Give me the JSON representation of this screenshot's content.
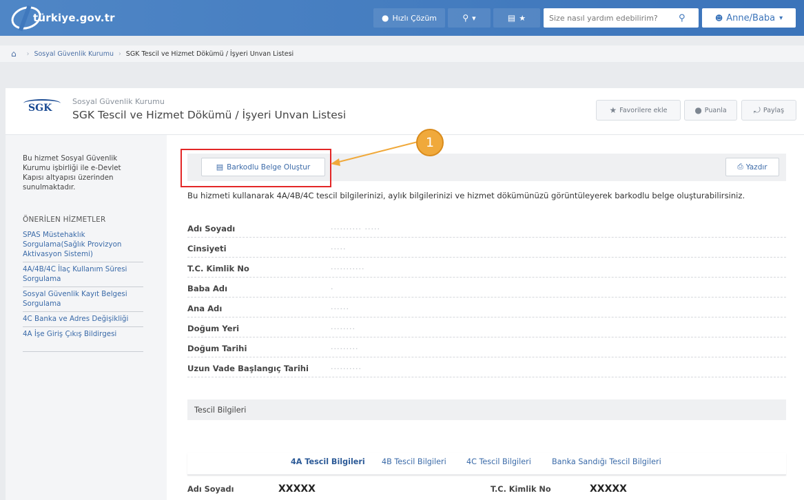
{
  "topbar": {
    "logo_text": "türkiye.gov.tr",
    "quick_solution_label": "Hızlı Çözüm",
    "search_placeholder": "Size nasıl yardım edebilirim?",
    "user_label": "Anne/Baba"
  },
  "breadcrumb": {
    "items": [
      "Sosyal Güvenlik Kurumu",
      "SGK Tescil ve Hizmet Dökümü / İşyeri Unvan Listesi"
    ]
  },
  "header": {
    "logo_text": "SGK",
    "org": "Sosyal Güvenlik Kurumu",
    "title": "SGK Tescil ve Hizmet Dökümü / İşyeri Unvan Listesi",
    "favorite_label": "Favorilere ekle",
    "rate_label": "Puanla",
    "share_label": "Paylaş"
  },
  "sidebar": {
    "description": "Bu hizmet Sosyal Güvenlik Kurumu işbirliği ile e-Devlet Kapısı altyapısı üzerinden sunulmaktadır.",
    "recommended_heading": "ÖNERİLEN HİZMETLER",
    "items": [
      "SPAS Müstehaklık Sorgulama(Sağlık Provizyon Aktivasyon Sistemi)",
      "4A/4B/4C İlaç Kullanım Süresi Sorgulama",
      "Sosyal Güvenlik Kayıt Belgesi Sorgulama",
      "4C Banka ve Adres Değişikliği",
      "4A İşe Giriş Çıkış Bildirgesi"
    ]
  },
  "content": {
    "barcode_button_label": "Barkodlu Belge Oluştur",
    "print_button_label": "Yazdır",
    "description": "Bu hizmeti kullanarak 4A/4B/4C tescil bilgilerinizi, aylık bilgilerinizi ve hizmet dökümünüzü görüntüleyerek barkodlu belge oluşturabilirsiniz.",
    "fields": [
      {
        "label": "Adı Soyadı",
        "value": "·········· ·····"
      },
      {
        "label": "Cinsiyeti",
        "value": "·····"
      },
      {
        "label": "T.C. Kimlik No",
        "value": "···········"
      },
      {
        "label": "Baba Adı",
        "value": "·"
      },
      {
        "label": "Ana Adı",
        "value": "······"
      },
      {
        "label": "Doğum Yeri",
        "value": "········"
      },
      {
        "label": "Doğum Tarihi",
        "value": "·········"
      },
      {
        "label": "Uzun Vade Başlangıç Tarihi",
        "value": "··········"
      }
    ],
    "section_title": "Tescil Bilgileri",
    "tabs": [
      "4A Tescil Bilgileri",
      "4B Tescil Bilgileri",
      "4C Tescil Bilgileri",
      "Banka Sandığı Tescil Bilgileri"
    ],
    "bottom_row": {
      "name_label": "Adı Soyadı",
      "name_value": "XXXXX",
      "tc_label": "T.C. Kimlik No",
      "tc_value": "XXXXX"
    }
  },
  "annotation": {
    "step_number": "1",
    "highlight_color": "#e32626",
    "arrow_color": "#f0a93b"
  },
  "icons": {
    "home": "home-icon",
    "chat": "chat-icon",
    "key": "key-icon",
    "card": "id-card-icon",
    "star": "star-icon",
    "search": "search-icon",
    "user": "user-icon",
    "barcode": "barcode-icon",
    "print": "printer-icon",
    "share": "share-icon"
  }
}
